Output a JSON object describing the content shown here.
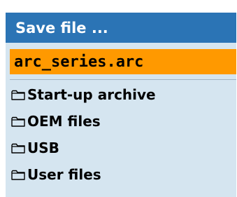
{
  "dialog": {
    "title": "Save file ...",
    "filename_value": "arc_series.arc",
    "folders": [
      {
        "label": "Start-up archive",
        "icon": "folder-icon"
      },
      {
        "label": "OEM files",
        "icon": "folder-icon"
      },
      {
        "label": "USB",
        "icon": "folder-icon"
      },
      {
        "label": "User files",
        "icon": "folder-icon"
      }
    ]
  },
  "colors": {
    "title_bar": "#2b74b5",
    "body_background": "#d5e5f0",
    "filename_highlight": "#ff9900"
  }
}
